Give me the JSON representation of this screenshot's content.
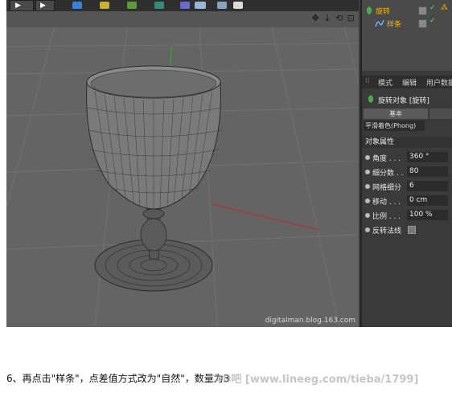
{
  "viewport": {
    "watermark": "digitalman.blog.163.com",
    "nav_icons": "✥ ↓ ⟲ ⊡"
  },
  "object_manager": {
    "rows": [
      {
        "label": "旋转",
        "icon": "lathe-nurbs-icon"
      },
      {
        "label": "样条",
        "icon": "spline-icon"
      }
    ]
  },
  "attributes": {
    "tabs": [
      "模式",
      "编辑",
      "用户数据"
    ],
    "object_title": "旋转对象 [旋转]",
    "tab_basic": "基本",
    "tab_phong": "平滑着色(Phong)",
    "section": "对象属性",
    "params": [
      {
        "label": "角度 . . .",
        "value": "360 °"
      },
      {
        "label": "细分数 . .",
        "value": "80"
      },
      {
        "label": "网格细分",
        "value": "6"
      },
      {
        "label": "移动 . . .",
        "value": "0 cm"
      },
      {
        "label": "比例 . . .",
        "value": "100 %"
      },
      {
        "label": "反转法线",
        "value": ""
      }
    ]
  },
  "caption": "6、再点击\"样条\"，点差值方式改为\"自然\"，数量为3",
  "caption_watermark": "C4D吧 [www.lineeg.com/tieba/1799]",
  "colors": {
    "accent": "#f2b400",
    "ok_green": "#7bd44a",
    "viewport_bg": "#646464"
  }
}
